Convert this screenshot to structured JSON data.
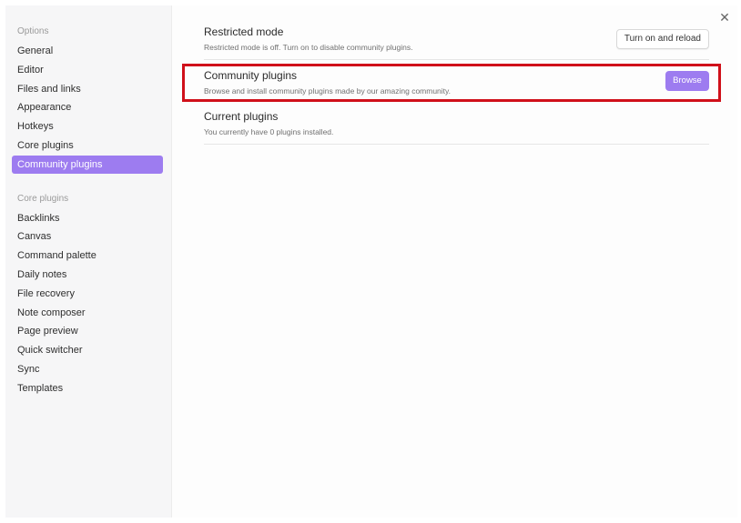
{
  "sidebar": {
    "options_label": "Options",
    "options_items": [
      "General",
      "Editor",
      "Files and links",
      "Appearance",
      "Hotkeys",
      "Core plugins",
      "Community plugins"
    ],
    "core_label": "Core plugins",
    "core_items": [
      "Backlinks",
      "Canvas",
      "Command palette",
      "Daily notes",
      "File recovery",
      "Note composer",
      "Page preview",
      "Quick switcher",
      "Sync",
      "Templates"
    ],
    "active_item": "Community plugins"
  },
  "close_icon": "✕",
  "settings": {
    "restricted": {
      "title": "Restricted mode",
      "desc": "Restricted mode is off. Turn on to disable community plugins.",
      "button": "Turn on and reload"
    },
    "community": {
      "title": "Community plugins",
      "desc": "Browse and install community plugins made by our amazing community.",
      "button": "Browse"
    },
    "current": {
      "title": "Current plugins",
      "desc": "You currently have 0 plugins installed."
    }
  },
  "colors": {
    "accent": "#9d7cf0",
    "highlight": "#d0101a"
  }
}
